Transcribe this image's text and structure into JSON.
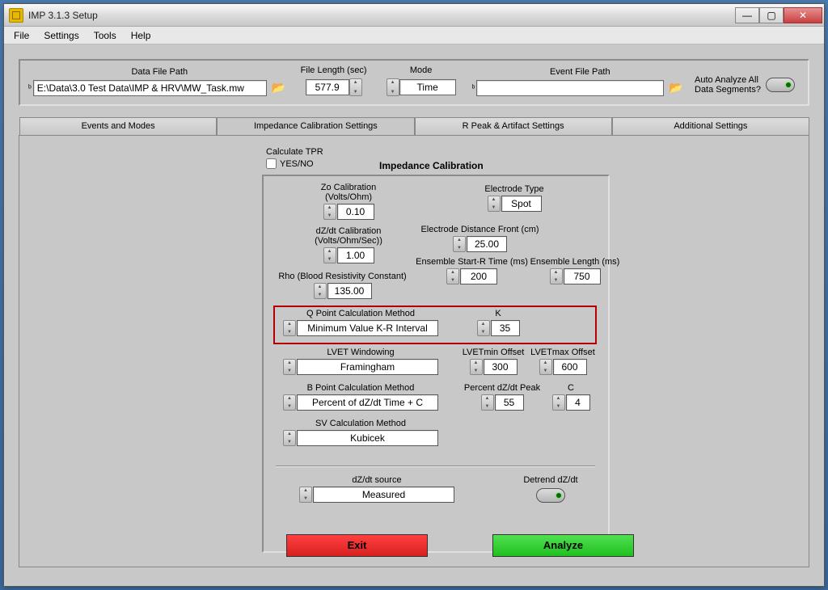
{
  "window": {
    "title": "IMP 3.1.3 Setup"
  },
  "menu": {
    "file": "File",
    "settings": "Settings",
    "tools": "Tools",
    "help": "Help"
  },
  "win_btn": {
    "min": "—",
    "max": "▢",
    "close": "✕"
  },
  "top": {
    "data_file_label": "Data File Path",
    "data_file_value": "E:\\Data\\3.0 Test Data\\IMP & HRV\\MW_Task.mw",
    "file_len_label": "File Length (sec)",
    "file_len_value": "577.9",
    "mode_label": "Mode",
    "mode_value": "Time",
    "event_file_label": "Event File Path",
    "event_file_value": "",
    "auto_label1": "Auto Analyze All",
    "auto_label2": "Data Segments?"
  },
  "tabs": {
    "t1": "Events and Modes",
    "t2": "Impedance Calibration Settings",
    "t3": "R Peak & Artifact Settings",
    "t4": "Additional Settings"
  },
  "panel": {
    "calc_tpr": "Calculate TPR",
    "yesno": "YES/NO",
    "title": "Impedance Calibration",
    "zo_label1": "Zo Calibration",
    "zo_label2": "(Volts/Ohm)",
    "zo_val": "0.10",
    "dzdt_label1": "dZ/dt Calibration",
    "dzdt_label2": "(Volts/Ohm/Sec))",
    "dzdt_val": "1.00",
    "rho_label": "Rho (Blood Resistivity Constant)",
    "rho_val": "135.00",
    "electrode_type_label": "Electrode Type",
    "electrode_type_val": "Spot",
    "electrode_dist_label": "Electrode Distance Front (cm)",
    "electrode_dist_val": "25.00",
    "ens_start_label": "Ensemble Start-R Time (ms)",
    "ens_start_val": "200",
    "ens_len_label": "Ensemble Length (ms)",
    "ens_len_val": "750",
    "qpoint_label": "Q Point Calculation Method",
    "qpoint_val": "Minimum Value K-R Interval",
    "k_label": "K",
    "k_val": "35",
    "lvet_win_label": "LVET Windowing",
    "lvet_win_val": "Framingham",
    "lvetmin_label": "LVETmin Offset",
    "lvetmin_val": "300",
    "lvetmax_label": "LVETmax Offset",
    "lvetmax_val": "600",
    "bpoint_label": "B Point Calculation Method",
    "bpoint_val": "Percent of dZ/dt Time + C",
    "percent_label": "Percent dZ/dt Peak",
    "percent_val": "55",
    "c_label": "C",
    "c_val": "4",
    "sv_label": "SV Calculation Method",
    "sv_val": "Kubicek",
    "dzdt_src_label": "dZ/dt source",
    "dzdt_src_val": "Measured",
    "detrend_label": "Detrend dZ/dt"
  },
  "buttons": {
    "exit": "Exit",
    "analyze": "Analyze"
  }
}
